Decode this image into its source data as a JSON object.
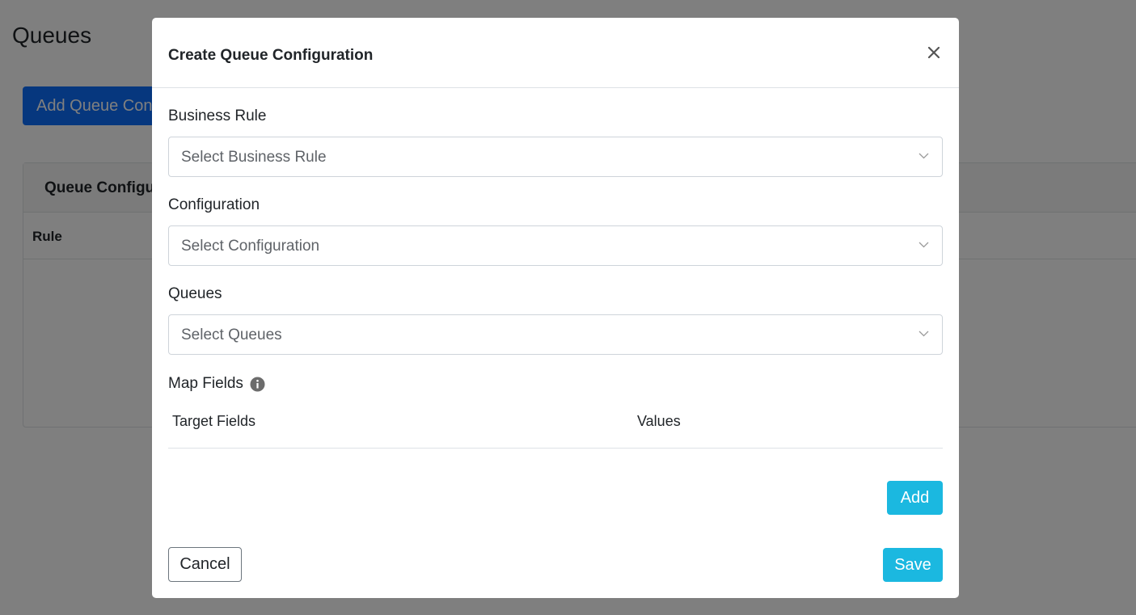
{
  "page": {
    "title": "Queues",
    "add_button_label": "Add Queue Configuration",
    "card_title": "Queue Configurations",
    "table_columns": [
      "Rule"
    ]
  },
  "modal": {
    "title": "Create Queue Configuration",
    "close_icon": "close-icon",
    "fields": {
      "business_rule": {
        "label": "Business Rule",
        "placeholder": "Select Business Rule"
      },
      "configuration": {
        "label": "Configuration",
        "placeholder": "Select Configuration"
      },
      "queues": {
        "label": "Queues",
        "placeholder": "Select Queues"
      }
    },
    "map_fields": {
      "label": "Map Fields",
      "info_icon": "info-icon",
      "columns": [
        "Target Fields",
        "Values"
      ]
    },
    "add_button_label": "Add",
    "cancel_button_label": "Cancel",
    "save_button_label": "Save"
  },
  "colors": {
    "primary": "#0d6efd",
    "info": "#1bb8e0",
    "backdrop": "rgba(0,0,0,0.5)"
  }
}
